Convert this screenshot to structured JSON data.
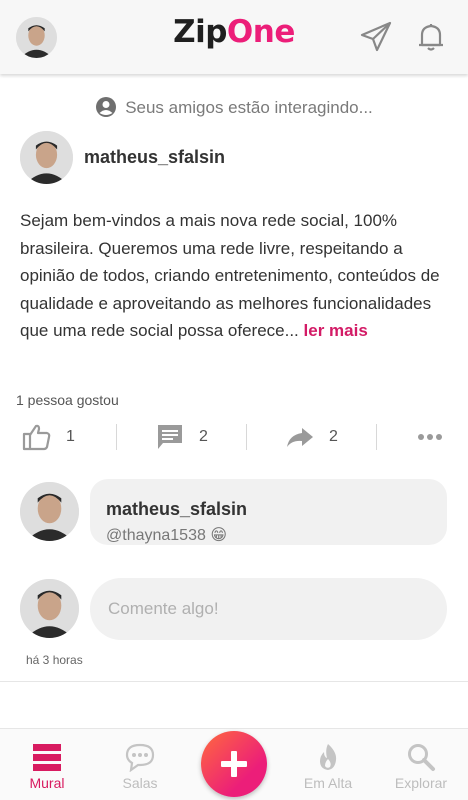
{
  "header": {
    "logo_part1": "Zip",
    "logo_part2": "One"
  },
  "friends_notice": "Seus amigos estão interagindo...",
  "post": {
    "author": "matheus_sfalsin",
    "text": "Sejam bem-vindos a mais nova rede social, 100% brasileira. Queremos uma rede livre, respeitando a opinião de todos, criando entretenimento, conteúdos de qualidade e aproveitando as melhores funcionalidades que uma rede social possa oferece...",
    "read_more": "ler mais",
    "likes_text": "1 pessoa gostou",
    "actions": {
      "like_count": "1",
      "comment_count": "2",
      "share_count": "2"
    },
    "comment": {
      "author": "matheus_sfalsin",
      "text": "@thayna1538",
      "emoji": "😁"
    },
    "comment_input": {
      "placeholder": "Comente algo!"
    },
    "time": "há 3 horas"
  },
  "nav": {
    "mural": "Mural",
    "salas": "Salas",
    "em_alta": "Em Alta",
    "explorar": "Explorar"
  },
  "colors": {
    "accent": "#ec1e79",
    "link": "#d31b66",
    "inactive": "#bdbdbd"
  }
}
